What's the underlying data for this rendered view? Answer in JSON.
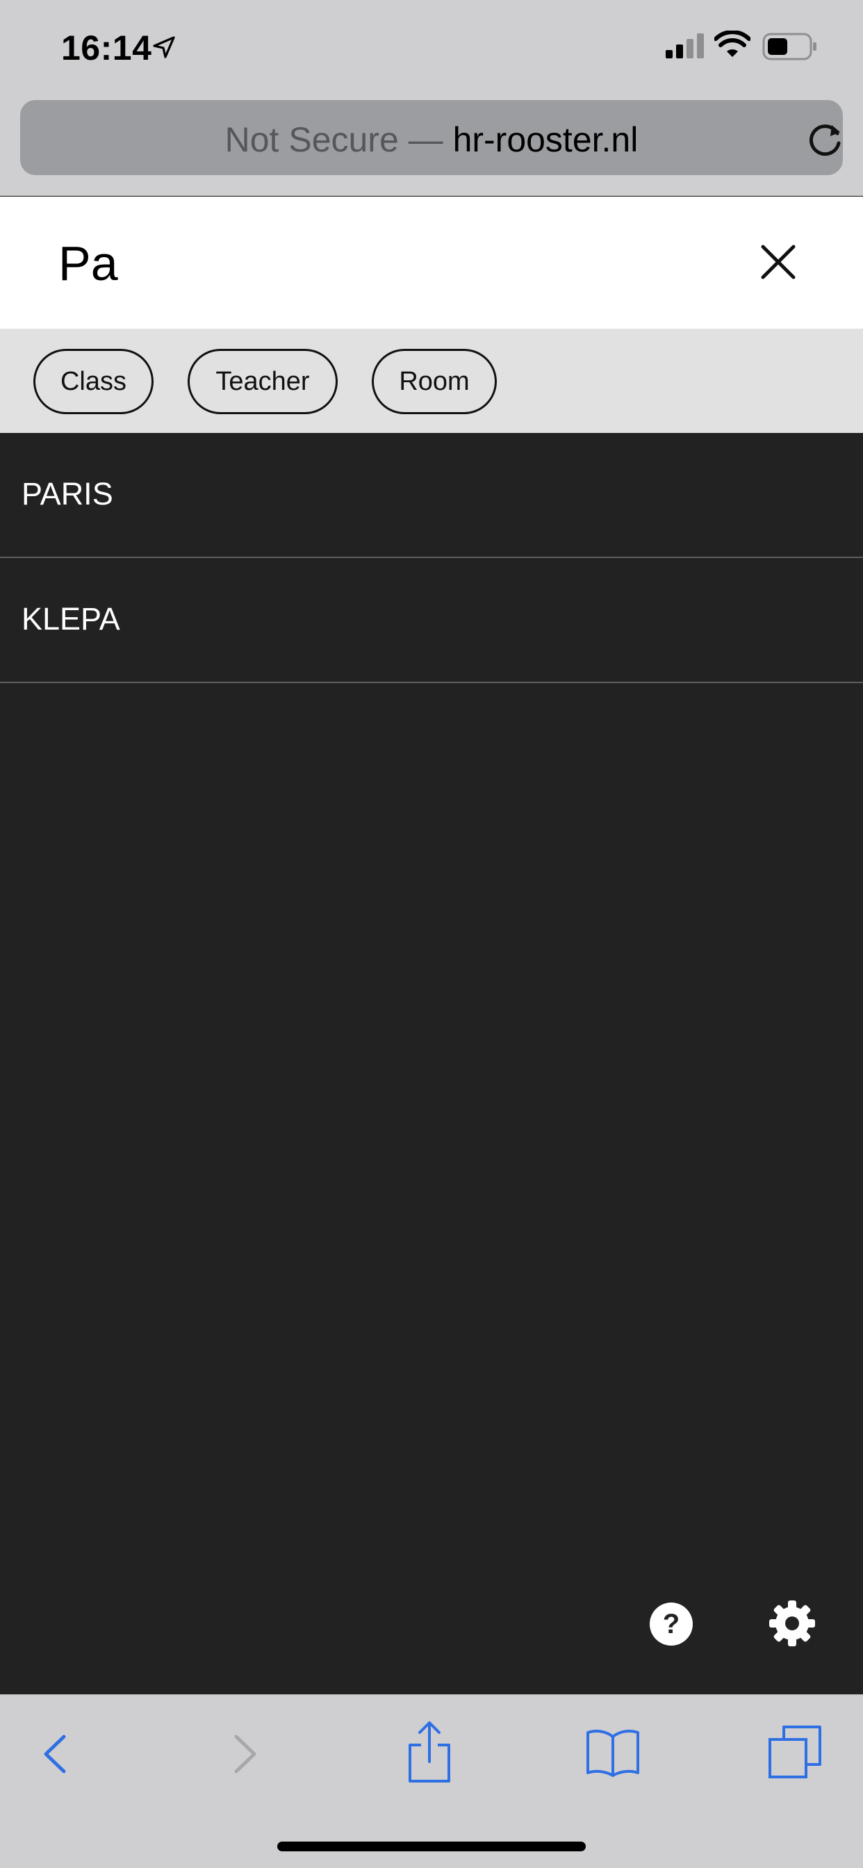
{
  "status_bar": {
    "time": "16:14",
    "icons": [
      "location-arrow-icon",
      "cellular-signal-icon",
      "wifi-icon",
      "battery-icon"
    ]
  },
  "browser": {
    "security_label": "Not Secure —",
    "domain": "hr-rooster.nl"
  },
  "search": {
    "query": "Pa"
  },
  "filters": [
    {
      "label": "Class"
    },
    {
      "label": "Teacher"
    },
    {
      "label": "Room"
    }
  ],
  "results": [
    {
      "label": "PARIS"
    },
    {
      "label": "KLEPA"
    }
  ],
  "colors": {
    "chrome_bg": "#cfcfd1",
    "content_bg": "#222222",
    "filter_bg": "#e1e1e1",
    "ios_blue": "#2f6fe4",
    "disabled_gray": "#a7a7aa"
  },
  "toolbar": {
    "icons": [
      "back-chevron-icon",
      "forward-chevron-icon",
      "share-icon",
      "bookmarks-icon",
      "tabs-icon"
    ]
  }
}
